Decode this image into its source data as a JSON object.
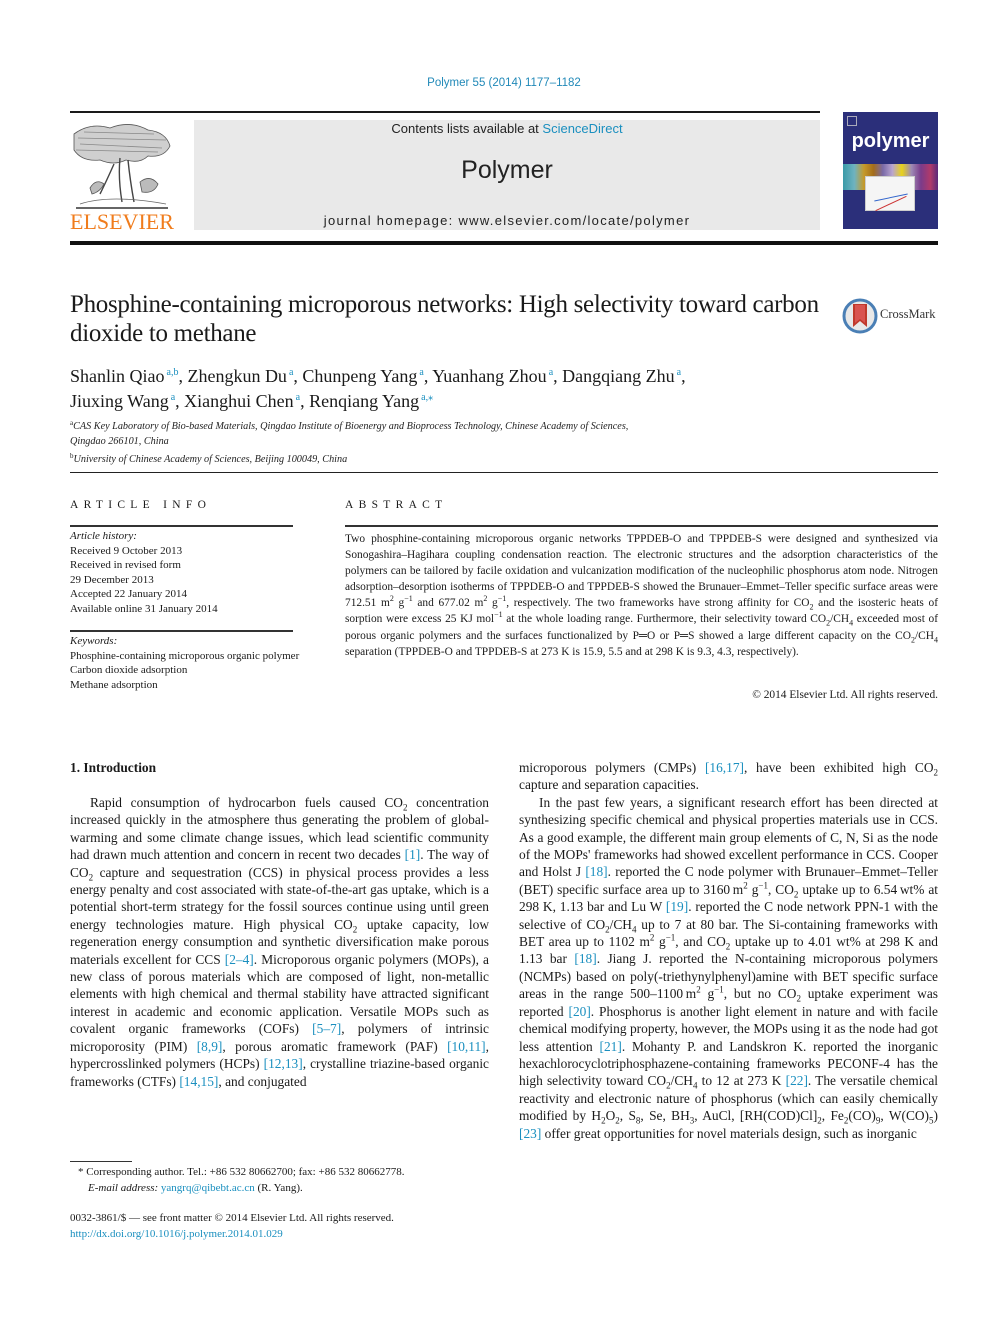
{
  "journal_ref": "Polymer 55 (2014) 1177–1182",
  "header": {
    "contents_prefix": "Contents lists available at ",
    "contents_link": "ScienceDirect",
    "journal_title": "Polymer",
    "homepage": "journal homepage: www.elsevier.com/locate/polymer",
    "publisher_logo_text": "ELSEVIER",
    "cover_title": "polymer",
    "publisher_color": "#f07c1c",
    "cover_color": "#2b2f7a"
  },
  "article": {
    "title": "Phosphine-containing microporous networks: High selectivity toward carbon dioxide to methane",
    "crossmark_label": "CrossMark",
    "authors": [
      {
        "name": "Shanlin Qiao",
        "aff": "a,b",
        "sep": ", "
      },
      {
        "name": "Zhengkun Du",
        "aff": "a",
        "sep": ", "
      },
      {
        "name": "Chunpeng Yang",
        "aff": "a",
        "sep": ", "
      },
      {
        "name": "Yuanhang Zhou",
        "aff": "a",
        "sep": ", "
      },
      {
        "name": "Dangqiang Zhu",
        "aff": "a",
        "sep": ","
      },
      {
        "name": "Jiuxing Wang",
        "aff": "a",
        "sep": ", "
      },
      {
        "name": "Xianghui Chen",
        "aff": "a",
        "sep": ", "
      },
      {
        "name": "Renqiang Yang",
        "aff": "a,⁎",
        "sep": ""
      }
    ],
    "affiliations": [
      {
        "mark": "a",
        "text": "CAS Key Laboratory of Bio-based Materials, Qingdao Institute of Bioenergy and Bioprocess Technology, Chinese Academy of Sciences,",
        "text2": "Qingdao 266101, China"
      },
      {
        "mark": "b",
        "text": "University of Chinese Academy of Sciences, Beijing 100049, China",
        "text2": ""
      }
    ]
  },
  "article_info": {
    "heading": "ARTICLE INFO",
    "history_label": "Article history:",
    "history": [
      "Received 9 October 2013",
      "Received in revised form",
      "29 December 2013",
      "Accepted 22 January 2014",
      "Available online 31 January 2014"
    ],
    "keywords_label": "Keywords:",
    "keywords": [
      "Phosphine-containing microporous organic polymer",
      "Carbon dioxide adsorption",
      "Methane adsorption"
    ]
  },
  "abstract": {
    "heading": "ABSTRACT",
    "segments": [
      {
        "t": "Two phosphine-containing microporous organic networks TPPDEB-O and TPPDEB-S were designed and synthesized via Sonogashira–Hagihara coupling condensation reaction. The electronic structures and the adsorption characteristics of the polymers can be tailored by facile oxidation and vulcanization modification of the nucleophilic phosphorus atom node. Nitrogen adsorption–desorption isotherms of TPPDEB-O and TPPDEB-S showed the Brunauer–Emmet–Teller specific surface areas were 712.51 m"
      },
      {
        "sup": "2"
      },
      {
        "t": " g"
      },
      {
        "sup": "−1"
      },
      {
        "t": " and 677.02 m"
      },
      {
        "sup": "2"
      },
      {
        "t": " g"
      },
      {
        "sup": "−1"
      },
      {
        "t": ", respectively. The two frameworks have strong affinity for CO"
      },
      {
        "sub": "2"
      },
      {
        "t": " and the isosteric heats of sorption were excess 25 KJ mol"
      },
      {
        "sup": "−1"
      },
      {
        "t": " at the whole loading range. Furthermore, their selectivity toward CO"
      },
      {
        "sub": "2"
      },
      {
        "t": "/CH"
      },
      {
        "sub": "4"
      },
      {
        "t": " exceeded most of porous organic polymers and the surfaces functionalized by P═O or P═S showed a large different capacity on the CO"
      },
      {
        "sub": "2"
      },
      {
        "t": "/CH"
      },
      {
        "sub": "4"
      },
      {
        "t": " separation (TPPDEB-O and TPPDEB-S at 273 K is 15.9, 5.5 and at 298 K is 9.3, 4.3, respectively)."
      }
    ],
    "copyright": "© 2014 Elsevier Ltd. All rights reserved."
  },
  "body": {
    "section_heading": "1.  Introduction",
    "left_column": [
      {
        "t": "Rapid consumption of hydrocarbon fuels caused CO"
      },
      {
        "sub": "2"
      },
      {
        "t": " concentration increased quickly in the atmosphere thus generating the problem of global-warming and some climate change issues, which lead scientific community had drawn much attention and concern in recent two decades "
      },
      {
        "ref": "[1]"
      },
      {
        "t": ". The way of CO"
      },
      {
        "sub": "2"
      },
      {
        "t": " capture and sequestration (CCS) in physical process provides a less energy penalty and cost associated with state-of-the-art gas uptake, which is a potential short-term strategy for the fossil sources continue using until green energy technologies mature. High physical CO"
      },
      {
        "sub": "2"
      },
      {
        "t": " uptake capacity, low regeneration energy consumption and synthetic diversification make porous materials excellent for CCS "
      },
      {
        "ref": "[2–4]"
      },
      {
        "t": ". Microporous organic polymers (MOPs), a new class of porous materials which are composed of light, non-metallic elements with high chemical and thermal stability have attracted significant interest in academic and economic application. Versatile MOPs such as covalent organic frameworks (COFs) "
      },
      {
        "ref": "[5–7]"
      },
      {
        "t": ", polymers of intrinsic microporosity (PIM) "
      },
      {
        "ref": "[8,9]"
      },
      {
        "t": ", porous aromatic framework (PAF) "
      },
      {
        "ref": "[10,11]"
      },
      {
        "t": ", hypercrosslinked polymers (HCPs) "
      },
      {
        "ref": "[12,13]"
      },
      {
        "t": ", crystalline triazine-based organic frameworks (CTFs) "
      },
      {
        "ref": "[14,15]"
      },
      {
        "t": ", and conjugated"
      }
    ],
    "right_column_p1": [
      {
        "t": "microporous polymers (CMPs) "
      },
      {
        "ref": "[16,17]"
      },
      {
        "t": ", have been exhibited high CO"
      },
      {
        "sub": "2"
      },
      {
        "t": " capture and separation capacities."
      }
    ],
    "right_column_p2": [
      {
        "t": "In the past few years, a significant research effort has been directed at synthesizing specific chemical and physical properties materials use in CCS. As a good example, the different main group elements of C, N, Si as the node of the MOPs' frameworks had showed excellent performance in CCS. Cooper and Holst J "
      },
      {
        "ref": "[18]"
      },
      {
        "t": ". reported the C node polymer with Brunauer–Emmet–Teller (BET) specific surface area up to 3160 m"
      },
      {
        "sup": "2"
      },
      {
        "t": " g"
      },
      {
        "sup": "−1"
      },
      {
        "t": ", CO"
      },
      {
        "sub": "2"
      },
      {
        "t": " uptake up to 6.54 wt% at 298 K, 1.13 bar and Lu W "
      },
      {
        "ref": "[19]"
      },
      {
        "t": ". reported the C node network PPN-1 with the selective of CO"
      },
      {
        "sub": "2"
      },
      {
        "t": "/CH"
      },
      {
        "sub": "4"
      },
      {
        "t": " up to 7 at 80 bar. The Si-containing frameworks with BET area up to 1102 m"
      },
      {
        "sup": "2"
      },
      {
        "t": " g"
      },
      {
        "sup": "−1"
      },
      {
        "t": ", and CO"
      },
      {
        "sub": "2"
      },
      {
        "t": " uptake up to 4.01 wt% at 298 K and 1.13 bar "
      },
      {
        "ref": "[18]"
      },
      {
        "t": ". Jiang J. reported the N-containing microporous polymers (NCMPs) based on poly(-triethynylphenyl)amine with BET specific surface areas in the range 500–1100 m"
      },
      {
        "sup": "2"
      },
      {
        "t": " g"
      },
      {
        "sup": "−1"
      },
      {
        "t": ", but no CO"
      },
      {
        "sub": "2"
      },
      {
        "t": " uptake experiment was reported "
      },
      {
        "ref": "[20]"
      },
      {
        "t": ". Phosphorus is another light element in nature and with facile chemical modifying property, however, the MOPs using it as the node had got less attention "
      },
      {
        "ref": "[21]"
      },
      {
        "t": ". Mohanty P. and Landskron K. reported the inorganic hexachlorocyclotriphosphazene-containing frameworks PECONF-4 has the high selectivity toward CO"
      },
      {
        "sub": "2"
      },
      {
        "t": "/CH"
      },
      {
        "sub": "4"
      },
      {
        "t": " to 12 at 273 K "
      },
      {
        "ref": "[22]"
      },
      {
        "t": ". The versatile chemical reactivity and electronic nature of phosphorus (which can easily chemically modified by H"
      },
      {
        "sub": "2"
      },
      {
        "t": "O"
      },
      {
        "sub": "2"
      },
      {
        "t": ", S"
      },
      {
        "sub": "8"
      },
      {
        "t": ", Se, BH"
      },
      {
        "sub": "3"
      },
      {
        "t": ", AuCl, [RH(COD)Cl]"
      },
      {
        "sub": "2"
      },
      {
        "t": ", Fe"
      },
      {
        "sub": "2"
      },
      {
        "t": "(CO)"
      },
      {
        "sub": "9"
      },
      {
        "t": ", W(CO)"
      },
      {
        "sub": "5"
      },
      {
        "t": ") "
      },
      {
        "ref": "[23]"
      },
      {
        "t": " offer great opportunities for novel materials design, such as inorganic"
      }
    ]
  },
  "footnote": {
    "star": "*",
    "corresponding": " Corresponding author. Tel.: +86 532 80662700; fax: +86 532 80662778.",
    "email_label": "E-mail address:",
    "email": "yangrq@qibebt.ac.cn",
    "email_suffix": " (R. Yang)."
  },
  "front_matter": {
    "issn_line": "0032-3861/$ — see front matter © 2014 Elsevier Ltd. All rights reserved.",
    "doi": "http://dx.doi.org/10.1016/j.polymer.2014.01.029"
  },
  "colors": {
    "link": "#1a8fbf",
    "header_band": "#e9e9e9"
  }
}
